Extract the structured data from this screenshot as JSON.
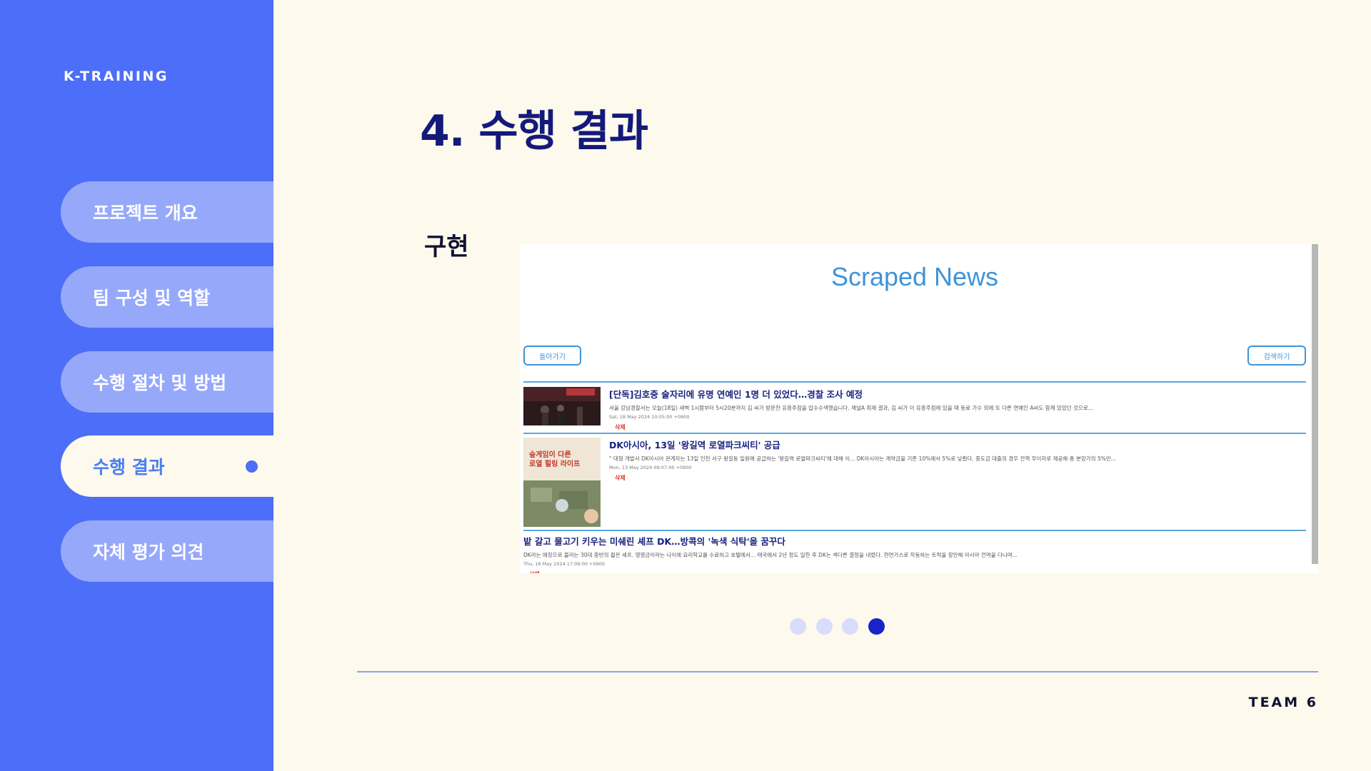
{
  "brand": "K-TRAINING",
  "nav": {
    "items": [
      {
        "label": "프로젝트 개요"
      },
      {
        "label": "팀 구성 및 역할"
      },
      {
        "label": "수행 절차 및 방법"
      },
      {
        "label": "수행 결과"
      },
      {
        "label": "자체 평가 의견"
      }
    ],
    "active_index": 3
  },
  "page_title": "4. 수행 결과",
  "section_label": "구현",
  "screenshot": {
    "title": "Scraped News",
    "back_button": "돌아가기",
    "search_button": "검색하기",
    "news": [
      {
        "title": "[단독]김호중 술자리에 유명 연예인 1명 더 있었다…경찰 조사 예정",
        "desc": "서울 강남경찰서는 오늘(18일) 새벽 1시쯤부터 5시20분까지 김 씨가 방문한 유흥주점을 압수수색했습니다. 채널A 취재 결과, 김 씨가 이 유흥주점에 있을 때 동료 가수 외에 또 다른 연예인 A씨도 함께 있었던 것으로...",
        "date": "Sat, 18 May 2024 10:05:00 +0900",
        "delete": "삭제"
      },
      {
        "title": "DK아시아, 13일 '왕길역 로열파크씨티' 공급",
        "desc": "\" 대형 개발사 DK아시아 관계자는 13일 인천 서구 왕길동 일원에 공급하는 '왕길역 로열파크씨티'에 대해 이... DK아시아는 계약금을 기존 10%에서 5%로 낮췄다. 중도금 대출의 경우 전액 무이자로 제공해 총 분양가의 5%만...",
        "date": "Mon, 13 May 2024 09:07:00 +0900",
        "delete": "삭제",
        "thumb_lines": [
          "숲게임이 다른",
          "로열 힐링 라이프"
        ]
      },
      {
        "title": "밭 갈고 물고기 키우는 미쉐린 셰프 DK…방콕의 '녹색 식탁'을 꿈꾸다",
        "desc": "DK라는 애칭으로 불리는 30대 중반의 젊은 셰프. 영영금이라는 나이에 요리학교를 수료하고 호텔에서... 태국에서 2년 정도 일한 후 DK는 색다른 결정을 내렸다. 현연가스로 작동하는 트럭을 장만해 아시아 전역을 다니며...",
        "date": "Thu, 16 May 2024 17:09:00 +0900",
        "delete": "삭제"
      }
    ]
  },
  "pagination": {
    "total": 4,
    "current": 4
  },
  "footer": "TEAM 6",
  "colors": {
    "sidebar": "#4d6ef8",
    "nav_inactive": "#96a8f9",
    "background": "#fdf9ec",
    "title": "#14197a",
    "accent_blue": "#3f94d8",
    "dot_active": "#1a23c9",
    "delete_red": "#e0352b"
  }
}
